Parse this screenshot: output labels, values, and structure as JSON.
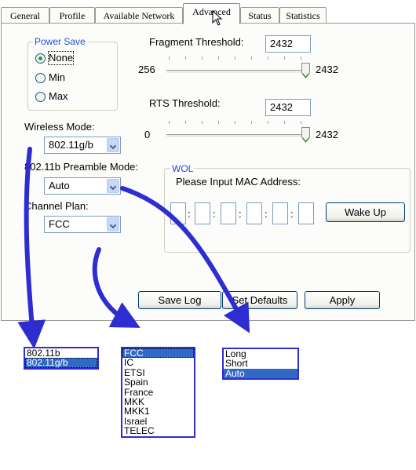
{
  "tabs": [
    "General",
    "Profile",
    "Available Network",
    "Advanced",
    "Status",
    "Statistics"
  ],
  "power_save": {
    "title": "Power Save",
    "options": [
      "None",
      "Min",
      "Max"
    ],
    "selected": "None"
  },
  "fragment_threshold": {
    "label": "Fragment Threshold:",
    "value": "2432",
    "min_label": "256",
    "max_label": "2432"
  },
  "rts_threshold": {
    "label": "RTS Threshold:",
    "value": "2432",
    "min_label": "0",
    "max_label": "2432"
  },
  "wireless_mode": {
    "label": "Wireless Mode:",
    "value": "802.11g/b"
  },
  "preamble_mode": {
    "label": "802.11b Preamble Mode:",
    "value": "Auto"
  },
  "channel_plan": {
    "label": "Channel Plan:",
    "value": "FCC"
  },
  "wol": {
    "title": "WOL",
    "prompt": "Please Input MAC Address:",
    "separator": ":",
    "wake_button": "Wake Up"
  },
  "buttons": {
    "save_log": "Save Log",
    "set_defaults": "Set Defaults",
    "apply": "Apply"
  },
  "dropdown_lists": {
    "wireless_mode": {
      "items": [
        "802.11b",
        "802.11g/b"
      ],
      "highlighted": "802.11g/b"
    },
    "channel_plan": {
      "items": [
        "FCC",
        "IC",
        "ETSI",
        "Spain",
        "France",
        "MKK",
        "MKK1",
        "Israel",
        "TELEC"
      ],
      "highlighted": "FCC"
    },
    "preamble_mode": {
      "items": [
        "Long",
        "Short",
        "Auto"
      ],
      "highlighted": "Auto"
    }
  },
  "colors": {
    "accent": "#316ac5",
    "annotation_arrow": "#2d2dd1",
    "group_title": "#2150c8",
    "radio_dot": "#21a121"
  },
  "icons": {
    "cursor": "mouse-pointer-icon",
    "dropdown": "chevron-down-icon"
  }
}
